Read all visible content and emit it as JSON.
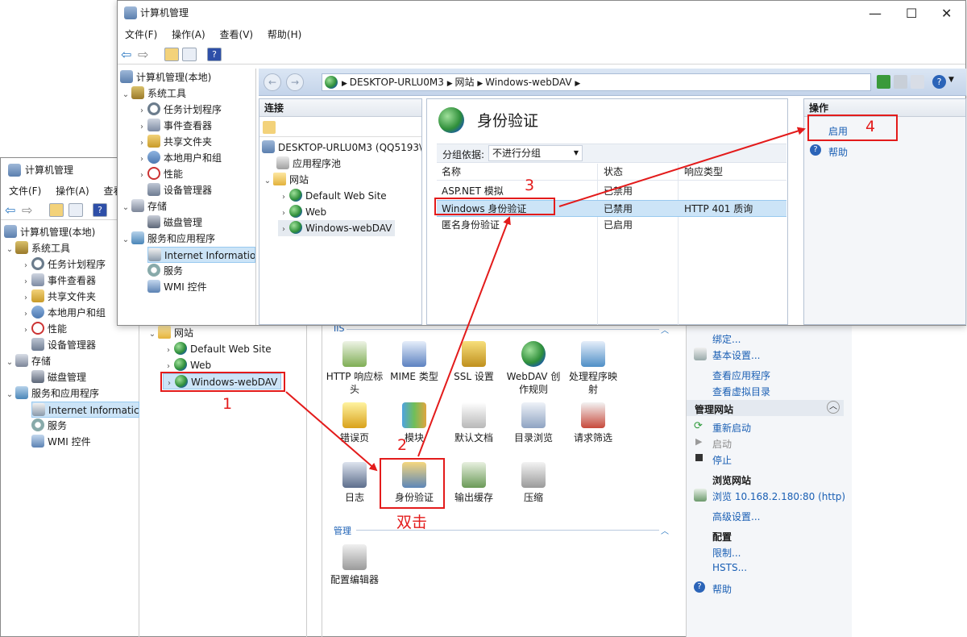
{
  "back_window": {
    "title": "计算机管理",
    "menu": [
      "文件(F)",
      "操作(A)",
      "查看"
    ],
    "tree": [
      {
        "label": "计算机管理(本地)",
        "icon": "computer-icon"
      },
      {
        "label": "系统工具",
        "icon": "tools-icon"
      },
      {
        "label": "任务计划程序",
        "icon": "clock-icon"
      },
      {
        "label": "事件查看器",
        "icon": "event-log-icon"
      },
      {
        "label": "共享文件夹",
        "icon": "shared-folder-icon"
      },
      {
        "label": "本地用户和组",
        "icon": "users-icon"
      },
      {
        "label": "性能",
        "icon": "performance-icon"
      },
      {
        "label": "设备管理器",
        "icon": "device-manager-icon"
      },
      {
        "label": "存储",
        "icon": "storage-icon"
      },
      {
        "label": "磁盘管理",
        "icon": "disk-icon"
      },
      {
        "label": "服务和应用程序",
        "icon": "services-apps-icon"
      },
      {
        "label": "Internet Informatic",
        "icon": "iis-icon"
      },
      {
        "label": "服务",
        "icon": "gear-icon"
      },
      {
        "label": "WMI 控件",
        "icon": "wmi-icon"
      }
    ],
    "sites_tree": [
      {
        "label": "网站",
        "icon": "folder-icon"
      },
      {
        "label": "Default Web Site",
        "icon": "globe-icon"
      },
      {
        "label": "Web",
        "icon": "globe-icon"
      },
      {
        "label": "Windows-webDAV",
        "icon": "globe-icon"
      }
    ],
    "features_group_iis": "IIS",
    "features": [
      {
        "label": "HTTP 响应标\n头"
      },
      {
        "label": "MIME 类型"
      },
      {
        "label": "SSL 设置"
      },
      {
        "label": "WebDAV 创\n作规则"
      },
      {
        "label": "处理程序映\n射"
      },
      {
        "label": "错误页"
      },
      {
        "label": "模块"
      },
      {
        "label": "默认文档"
      },
      {
        "label": "目录浏览"
      },
      {
        "label": "请求筛选"
      },
      {
        "label": "日志"
      },
      {
        "label": "身份验证"
      },
      {
        "label": "输出缓存"
      },
      {
        "label": "压缩"
      }
    ],
    "features_group_manage": "管理",
    "manage_features": [
      {
        "label": "配置编辑器"
      }
    ],
    "actions": {
      "bind": "绑定...",
      "basic_settings": "基本设置...",
      "view_apps": "查看应用程序",
      "view_vdirs": "查看虚拟目录",
      "manage_site_head": "管理网站",
      "restart": "重新启动",
      "start": "启动",
      "stop": "停止",
      "browse_head": "浏览网站",
      "browse_link": "浏览 10.168.2.180:80 (http)",
      "advanced": "高级设置...",
      "config_head": "配置",
      "limits": "限制...",
      "hsts": "HSTS...",
      "help": "帮助"
    }
  },
  "front_window": {
    "title": "计算机管理",
    "menu": [
      "文件(F)",
      "操作(A)",
      "查看(V)",
      "帮助(H)"
    ],
    "tree": [
      {
        "label": "计算机管理(本地)"
      },
      {
        "label": "系统工具"
      },
      {
        "label": "任务计划程序"
      },
      {
        "label": "事件查看器"
      },
      {
        "label": "共享文件夹"
      },
      {
        "label": "本地用户和组"
      },
      {
        "label": "性能"
      },
      {
        "label": "设备管理器"
      },
      {
        "label": "存储"
      },
      {
        "label": "磁盘管理"
      },
      {
        "label": "服务和应用程序"
      },
      {
        "label": "Internet Informatio"
      },
      {
        "label": "服务"
      },
      {
        "label": "WMI 控件"
      }
    ],
    "address_path": [
      "DESKTOP-URLU0M3",
      "网站",
      "Windows-webDAV"
    ],
    "connections": {
      "header": "连接",
      "server": "DESKTOP-URLU0M3 (QQ5193\\",
      "app_pools": "应用程序池",
      "sites": "网站",
      "site_items": [
        "Default Web Site",
        "Web",
        "Windows-webDAV"
      ]
    },
    "auth": {
      "title": "身份验证",
      "group_by_label": "分组依据:",
      "group_by_value": "不进行分组",
      "columns": [
        "名称",
        "状态",
        "响应类型"
      ],
      "rows": [
        {
          "name": "ASP.NET 模拟",
          "status": "已禁用",
          "response": ""
        },
        {
          "name": "Windows 身份验证",
          "status": "已禁用",
          "response": "HTTP 401 质询"
        },
        {
          "name": "匿名身份验证",
          "status": "已启用",
          "response": ""
        }
      ]
    },
    "actions": {
      "header": "操作",
      "enable": "启用",
      "help": "帮助"
    }
  },
  "annotations": {
    "step1": "1",
    "step2": "2",
    "double_click": "双击",
    "step3": "3",
    "step4": "4",
    "color": "#e31b1b"
  }
}
